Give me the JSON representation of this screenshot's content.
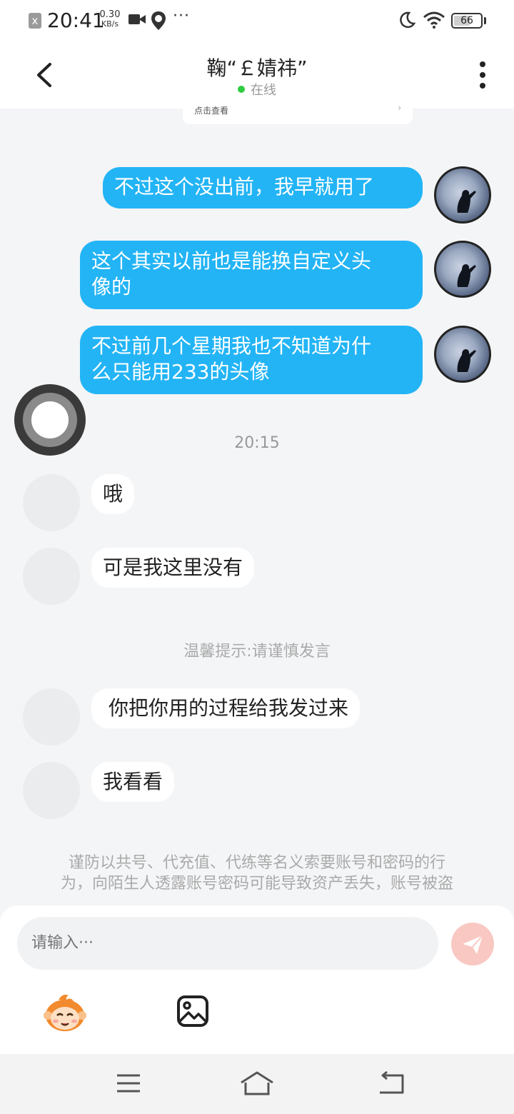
{
  "status_bar": {
    "close_badge": "x",
    "time": "20:41",
    "speed_value": "0.30",
    "speed_unit": "KB/s",
    "more": "···",
    "battery_level": "66",
    "battery_fraction": 0.66
  },
  "header": {
    "title": "鞠“￡婧祎”",
    "status": "在线"
  },
  "partial_card": {
    "text": "点击查看"
  },
  "messages": {
    "sent_1": "不过这个没出前，我早就用了",
    "sent_2_line1": "这个其实以前也是能换自定义头",
    "sent_2_line2": "像的",
    "sent_3_line1": "不过前几个星期我也不知道为什",
    "sent_3_line2": "么只能用233的头像",
    "timestamp": "20:15",
    "received_1": "哦",
    "received_2": "可是我这里没有",
    "tip": "温馨提示:请谨慎发言",
    "received_3": "你把你用的过程给我发过来",
    "received_4": "我看看"
  },
  "warning": {
    "line1": "谨防以共号、代充值、代练等名义索要账号和密码的行",
    "line2": "为，向陌生人透露账号密码可能导致资产丢失，账号被盗"
  },
  "input": {
    "placeholder": "请输入···"
  },
  "colors": {
    "sent_bubble": "#23b4f5",
    "online_dot": "#2ecc40",
    "send_button": "#f9c8c2",
    "background": "#f4f5f7"
  },
  "icons": {
    "back": "chevron-left-icon",
    "menu": "vertical-dots-icon",
    "send": "paper-plane-icon",
    "emoji": "monkey-emoji-icon",
    "image": "image-icon",
    "nav_menu": "hamburger-icon",
    "nav_home": "home-icon",
    "nav_back": "return-icon"
  }
}
